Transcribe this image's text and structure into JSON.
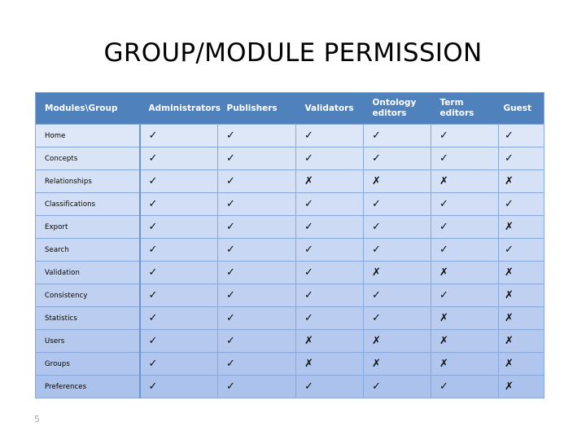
{
  "slide": {
    "title": "GROUP/MODULE PERMISSION",
    "page_number": "5",
    "accent_color": "#4f81bd",
    "header_text_color": "#ffffff",
    "grid_line_color": "#87a8d8",
    "page_number_color": "#a6a6a6"
  },
  "table": {
    "columns": [
      "Modules\\Group",
      "Administrators",
      "Publishers",
      "Validators",
      "Ontology editors",
      "Term editors",
      "Guest"
    ],
    "allow_glyph": "✓",
    "deny_glyph": "✗",
    "rows": [
      {
        "module": "Home",
        "cells": [
          "✓",
          "✓",
          "✓",
          "✓",
          "✓",
          "✓"
        ]
      },
      {
        "module": "Concepts",
        "cells": [
          "✓",
          "✓",
          "✓",
          "✓",
          "✓",
          "✓"
        ]
      },
      {
        "module": "Relationships",
        "cells": [
          "✓",
          "✓",
          "✗",
          "✗",
          "✗",
          "✗"
        ]
      },
      {
        "module": "Classifications",
        "cells": [
          "✓",
          "✓",
          "✓",
          "✓",
          "✓",
          "✓"
        ]
      },
      {
        "module": "Export",
        "cells": [
          "✓",
          "✓",
          "✓",
          "✓",
          "✓",
          "✗"
        ]
      },
      {
        "module": "Search",
        "cells": [
          "✓",
          "✓",
          "✓",
          "✓",
          "✓",
          "✓"
        ]
      },
      {
        "module": "Validation",
        "cells": [
          "✓",
          "✓",
          "✓",
          "✗",
          "✗",
          "✗"
        ]
      },
      {
        "module": "Consistency",
        "cells": [
          "✓",
          "✓",
          "✓",
          "✓",
          "✓",
          "✗"
        ]
      },
      {
        "module": "Statistics",
        "cells": [
          "✓",
          "✓",
          "✓",
          "✓",
          "✗",
          "✗"
        ]
      },
      {
        "module": "Users",
        "cells": [
          "✓",
          "✓",
          "✗",
          "✗",
          "✗",
          "✗"
        ]
      },
      {
        "module": "Groups",
        "cells": [
          "✓",
          "✓",
          "✗",
          "✗",
          "✗",
          "✗"
        ]
      },
      {
        "module": "Preferences",
        "cells": [
          "✓",
          "✓",
          "✓",
          "✓",
          "✓",
          "✗"
        ]
      }
    ]
  }
}
